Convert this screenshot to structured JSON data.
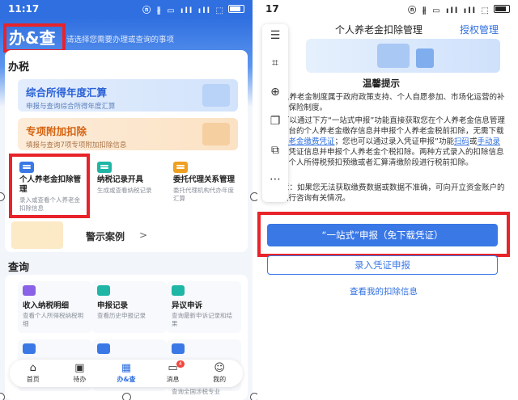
{
  "left": {
    "status": {
      "time": "11:17",
      "sys_icons": "ⓝ ∦ ▭ ıll ıll ⬚"
    },
    "header": {
      "title": "办&查",
      "hint": "请选择您需要办理或查询的事项"
    },
    "section_ban": "办税",
    "banners": [
      {
        "title": "综合所得年度汇算",
        "sub": "申报与查询综合所得年度汇算"
      },
      {
        "title": "专项附加扣除",
        "sub": "填报与查询7项专项附加扣除信息"
      }
    ],
    "tiles": [
      {
        "title": "个人养老金扣除管理",
        "sub": "录入或查看个人养老金扣除信息",
        "color": "#3a78e6"
      },
      {
        "title": "纳税记录开具",
        "sub": "生成或查看纳税记录",
        "color": "#1fb6a6"
      },
      {
        "title": "委托代理关系管理",
        "sub": "委托代理机构代办年度汇算",
        "color": "#f0a020"
      }
    ],
    "case_label": "警示案例",
    "section_cha": "查询",
    "query_tiles": [
      {
        "title": "收入纳税明细",
        "sub": "查看个人所得税纳税明细",
        "color": "#8a62e8"
      },
      {
        "title": "申报记录",
        "sub": "查看历史申报记录",
        "color": "#1fb6a6"
      },
      {
        "title": "异议申诉",
        "sub": "查询最新申诉记录和结果",
        "color": "#1fb6a6"
      },
      {
        "title": "",
        "sub": "信息",
        "color": "#3a78e6"
      },
      {
        "title": "",
        "sub": "",
        "color": "#3a78e6"
      },
      {
        "title": "",
        "sub": "查询全国涉税专业",
        "color": "#3a78e6"
      }
    ],
    "tabbar": [
      {
        "label": "首页",
        "glyph": "⌂"
      },
      {
        "label": "待办",
        "glyph": "▣"
      },
      {
        "label": "办&查",
        "glyph": "▦"
      },
      {
        "label": "消息",
        "glyph": "▭",
        "badge": "4"
      },
      {
        "label": "我的",
        "glyph": "☺"
      }
    ]
  },
  "right": {
    "status": {
      "time": "17",
      "sys_icons": "ⓝ ∦ ▭ ıll ıll ⬚"
    },
    "nav": {
      "back": "回",
      "title": "个人养老金扣除管理",
      "right": "授权管理"
    },
    "reminder_title": "温馨提示",
    "para1": "人养老金制度属于政府政策支持、个人自愿参加、市场化运营的补充养老保险制度。",
    "para2_a": "可以通过下方“一站式申报”功能直接获取您在个人养老金信息管理服务平台的个人养老金缴存信息并申报个人养老金税前扣除，无需下载",
    "para2_link1": "个人养老金缴费凭证",
    "para2_b": "；您也可以通过录入凭证申报”功能",
    "para2_link2": "扫码",
    "para2_c": "或",
    "para2_link3": "手动录入",
    "para2_d": "缴费凭证信息并申报个人养老金个税扣除。两种方式录入的扣除信息均可在个人所得税预扣预缴或者汇算清缴阶段进行税前扣除。",
    "para3": "意：如果您无法获取缴费数据或数据不准确，可向开立资金账户的商业银行咨询有关情况。",
    "btn_primary": "“一站式”申报（免下载凭证）",
    "btn_outline": "录入凭证申报",
    "link_view": "查看我的扣除信息",
    "tools": [
      "☰",
      "⌗",
      "⊕",
      "❐",
      "⧉",
      "⋯"
    ]
  }
}
